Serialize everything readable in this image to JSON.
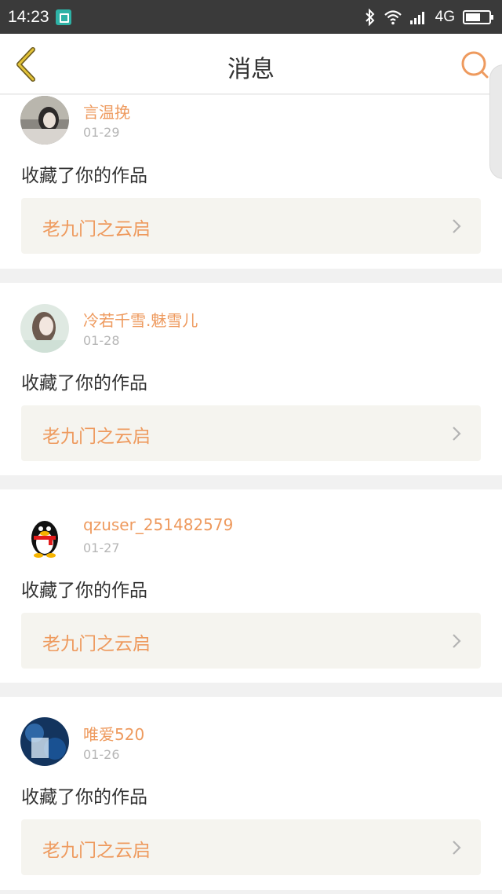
{
  "status_bar": {
    "time": "14:23",
    "network": "4G",
    "icons": [
      "screenshot-icon",
      "bluetooth-icon",
      "wifi-icon",
      "signal-icon",
      "battery-icon"
    ]
  },
  "header": {
    "title": "消息",
    "back_icon": "back-chevron-icon",
    "search_icon": "search-icon"
  },
  "colors": {
    "accent": "#ee9a5e",
    "back_icon": "#e3c338",
    "text_primary": "#333333",
    "text_secondary": "#b6b6b6",
    "work_bg": "#f5f4ef",
    "status_bar_bg": "#3a3a3a"
  },
  "messages": [
    {
      "username": "言温挽",
      "date": "01-29",
      "action": "收藏了你的作品",
      "work_title": "老九门之云启",
      "avatar": "photo-avatar"
    },
    {
      "username": "冷若千雪.魅雪儿",
      "date": "01-28",
      "action": "收藏了你的作品",
      "work_title": "老九门之云启",
      "avatar": "photo-avatar"
    },
    {
      "username": "qzuser_251482579",
      "date": "01-27",
      "action": "收藏了你的作品",
      "work_title": "老九门之云启",
      "avatar": "qq-penguin-avatar"
    },
    {
      "username": "唯爱520",
      "date": "01-26",
      "action": "收藏了你的作品",
      "work_title": "老九门之云启",
      "avatar": "photo-avatar"
    }
  ]
}
